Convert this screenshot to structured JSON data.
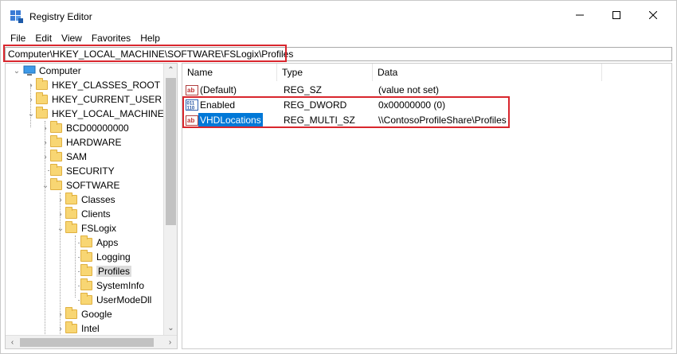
{
  "window": {
    "title": "Registry Editor"
  },
  "menu": [
    "File",
    "Edit",
    "View",
    "Favorites",
    "Help"
  ],
  "address": {
    "path": "Computer\\HKEY_LOCAL_MACHINE\\SOFTWARE\\FSLogix\\Profiles"
  },
  "tree": {
    "items": [
      {
        "label": "Computer",
        "icon": "computer-icon",
        "chevron": "expanded"
      },
      {
        "label": "HKEY_CLASSES_ROOT",
        "icon": "folder-icon",
        "chevron": "collapsed"
      },
      {
        "label": "HKEY_CURRENT_USER",
        "icon": "folder-icon",
        "chevron": "collapsed"
      },
      {
        "label": "HKEY_LOCAL_MACHINE",
        "icon": "folder-icon",
        "chevron": "expanded"
      },
      {
        "label": "BCD00000000",
        "icon": "folder-icon",
        "chevron": "collapsed"
      },
      {
        "label": "HARDWARE",
        "icon": "folder-icon",
        "chevron": "collapsed"
      },
      {
        "label": "SAM",
        "icon": "folder-icon",
        "chevron": "collapsed"
      },
      {
        "label": "SECURITY",
        "icon": "folder-icon",
        "chevron": "none"
      },
      {
        "label": "SOFTWARE",
        "icon": "folder-icon",
        "chevron": "expanded"
      },
      {
        "label": "Classes",
        "icon": "folder-icon",
        "chevron": "collapsed"
      },
      {
        "label": "Clients",
        "icon": "folder-icon",
        "chevron": "collapsed"
      },
      {
        "label": "FSLogix",
        "icon": "folder-icon",
        "chevron": "expanded"
      },
      {
        "label": "Apps",
        "icon": "folder-icon",
        "chevron": "none"
      },
      {
        "label": "Logging",
        "icon": "folder-icon",
        "chevron": "none"
      },
      {
        "label": "Profiles",
        "icon": "folder-icon",
        "chevron": "none",
        "selected": true
      },
      {
        "label": "SystemInfo",
        "icon": "folder-icon",
        "chevron": "none"
      },
      {
        "label": "UserModeDll",
        "icon": "folder-icon",
        "chevron": "none"
      },
      {
        "label": "Google",
        "icon": "folder-icon",
        "chevron": "collapsed"
      },
      {
        "label": "Intel",
        "icon": "folder-icon",
        "chevron": "collapsed"
      }
    ]
  },
  "values": {
    "columns": [
      "Name",
      "Type",
      "Data"
    ],
    "rows": [
      {
        "name": "(Default)",
        "type": "REG_SZ",
        "data": "(value not set)",
        "icon": "string-value-icon"
      },
      {
        "name": "Enabled",
        "type": "REG_DWORD",
        "data": "0x00000000 (0)",
        "icon": "binary-value-icon"
      },
      {
        "name": "VHDLocations",
        "type": "REG_MULTI_SZ",
        "data": "\\\\ContosoProfileShare\\Profiles",
        "icon": "string-value-icon",
        "selected": true
      }
    ]
  },
  "colors": {
    "highlight": "#d9262d",
    "selection": "#0078d7",
    "folder": "#f8d673"
  }
}
